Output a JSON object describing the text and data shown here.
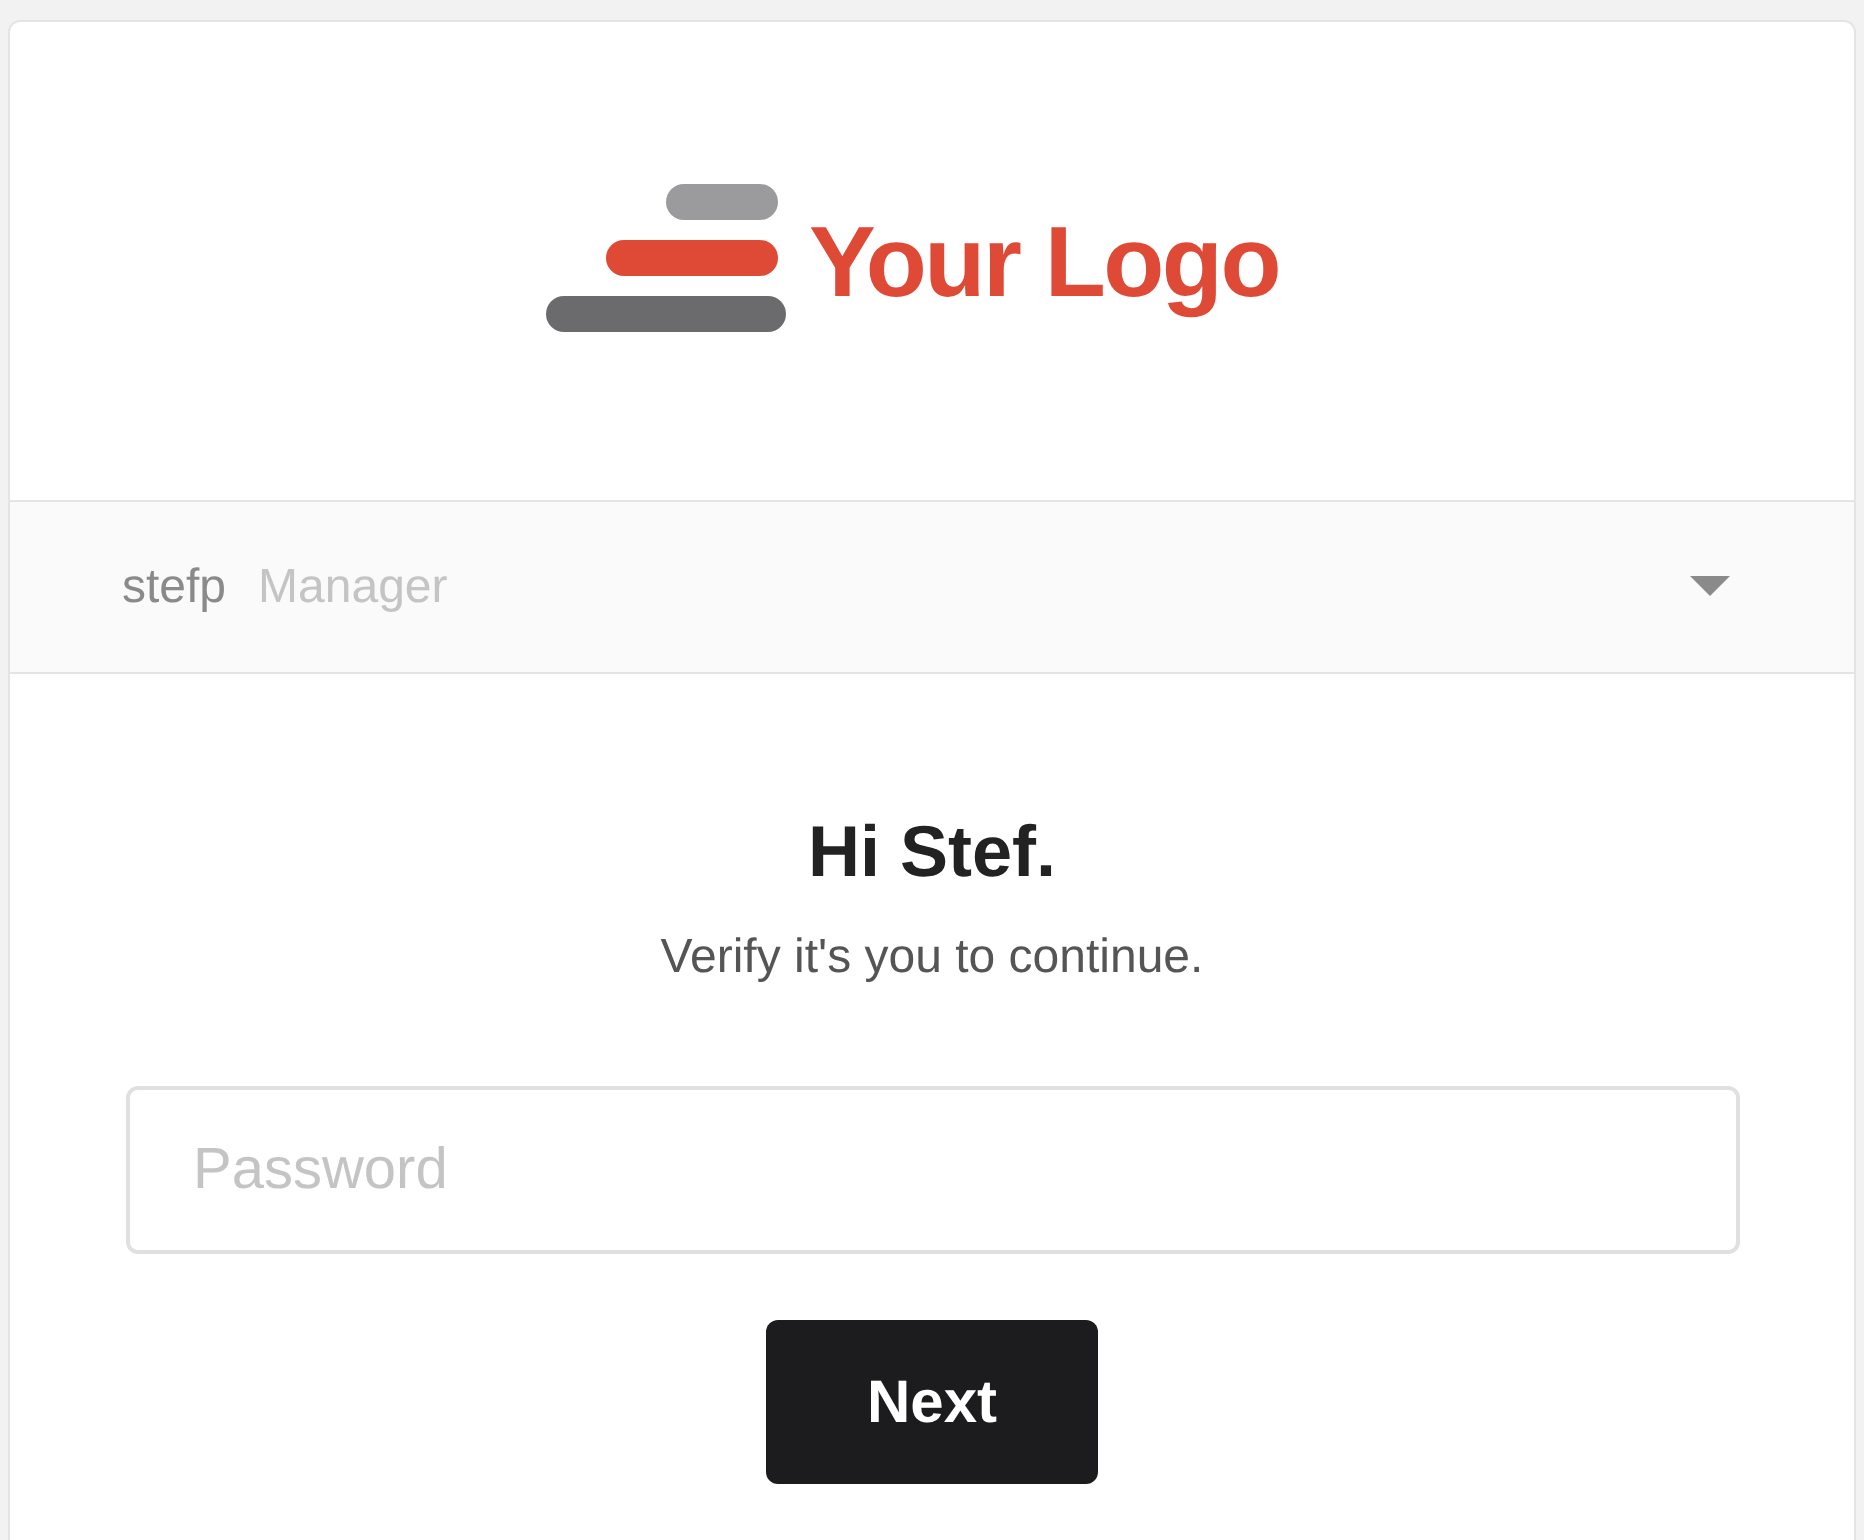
{
  "logo": {
    "text": "Your Logo"
  },
  "account": {
    "username": "stefp",
    "role": "Manager"
  },
  "greeting": {
    "title": "Hi Stef.",
    "subtitle": "Verify it's you to continue."
  },
  "password": {
    "placeholder": "Password"
  },
  "buttons": [
    {
      "label": "Next",
      "kind": "primary"
    }
  ]
}
